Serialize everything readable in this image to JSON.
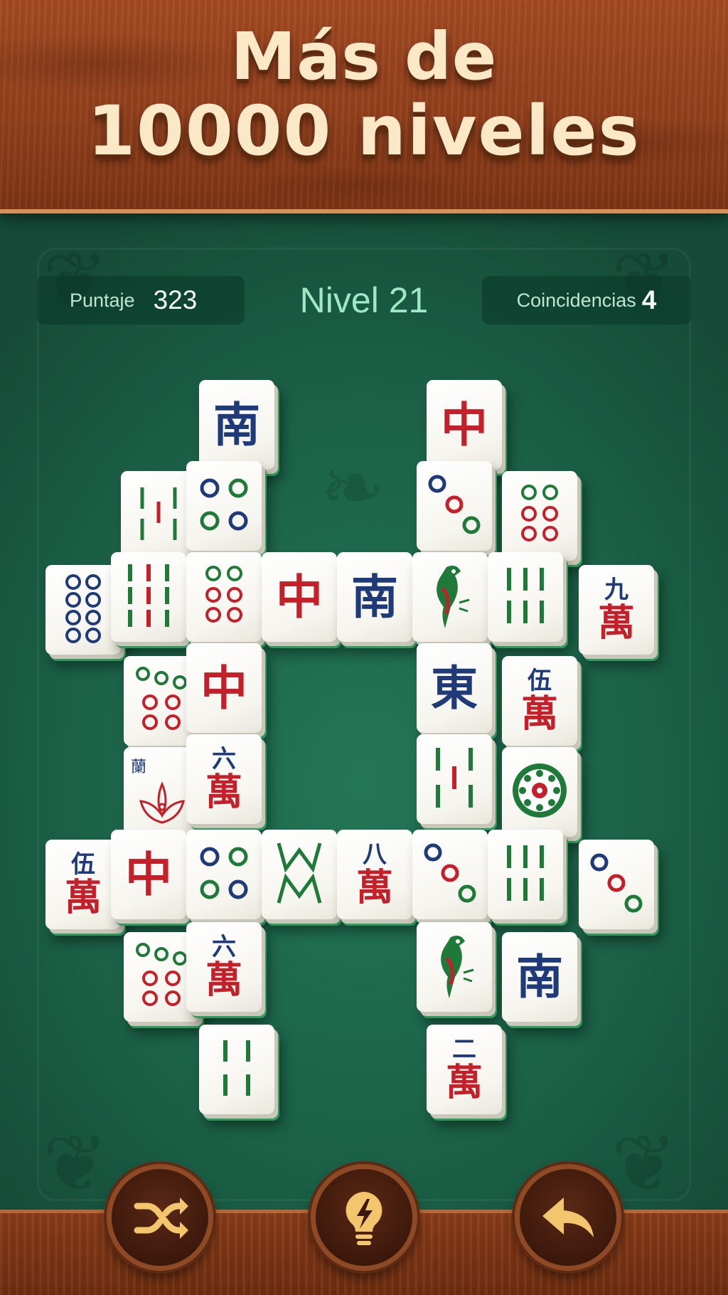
{
  "banner": {
    "line1": "Más de",
    "line2": "10000 niveles"
  },
  "hud": {
    "score_label": "Puntaje",
    "score_value": "323",
    "level_title": "Nivel 21",
    "matches_label": "Coincidencias",
    "matches_value": "4"
  },
  "colors": {
    "board_green": "#1d5e47",
    "wood": "#93401c",
    "headline": "#fbe8c6",
    "tile_red": "#c5202a",
    "tile_blue": "#1e3a78",
    "tile_green": "#1f7a3a"
  },
  "tiles": [
    {
      "glyph": "南",
      "kind": "south-wind"
    },
    {
      "glyph": "中",
      "kind": "red-dragon"
    },
    {
      "glyph": "𝍪",
      "kind": "bamboo-3"
    },
    {
      "glyph": "◎◎\n◎◎",
      "kind": "circles-4"
    },
    {
      "glyph": "◎◎\n◎◎",
      "kind": "circles-3"
    },
    {
      "glyph": "◎◎\n◎◎◎",
      "kind": "circles-6"
    },
    {
      "glyph": "◎◎\n◎◎\n◎◎",
      "kind": "circles-8"
    },
    {
      "glyph": "‖‖‖",
      "kind": "bamboo-9"
    },
    {
      "glyph": "◎◎\n◎◎◎",
      "kind": "circles-6"
    },
    {
      "glyph": "中",
      "kind": "red-dragon"
    },
    {
      "glyph": "南",
      "kind": "south-wind"
    },
    {
      "glyph": "🐦",
      "kind": "bamboo-1"
    },
    {
      "glyph": "‖‖‖",
      "kind": "bamboo-6"
    },
    {
      "num": "九",
      "wan": "萬",
      "kind": "characters-9"
    },
    {
      "glyph": "◎◎\n◎◎◎",
      "kind": "circles-7"
    },
    {
      "glyph": "中",
      "kind": "red-dragon"
    },
    {
      "glyph": "東",
      "kind": "east-wind"
    },
    {
      "num": "伍",
      "wan": "萬",
      "kind": "characters-5"
    },
    {
      "glyph": "蘭",
      "kind": "flower-orchid"
    },
    {
      "num": "六",
      "wan": "萬",
      "kind": "characters-6"
    },
    {
      "glyph": "‖|‖",
      "kind": "bamboo-5"
    },
    {
      "glyph": "❁",
      "kind": "circles-1"
    },
    {
      "num": "伍",
      "wan": "萬",
      "kind": "characters-5"
    },
    {
      "glyph": "中",
      "kind": "red-dragon"
    },
    {
      "glyph": "◎◎\n◎◎",
      "kind": "circles-4"
    },
    {
      "glyph": "WM",
      "kind": "bamboo-8"
    },
    {
      "num": "八",
      "wan": "萬",
      "kind": "characters-8"
    },
    {
      "glyph": "◎◎◎",
      "kind": "circles-3"
    },
    {
      "glyph": "‖‖‖",
      "kind": "bamboo-6"
    },
    {
      "glyph": "◎◎◎",
      "kind": "circles-3"
    },
    {
      "glyph": "◎◎\n◎◎◎",
      "kind": "circles-7"
    },
    {
      "num": "六",
      "wan": "萬",
      "kind": "characters-6"
    },
    {
      "glyph": "🐦",
      "kind": "bamboo-1"
    },
    {
      "glyph": "南",
      "kind": "south-wind"
    },
    {
      "glyph": "‖ ‖",
      "kind": "bamboo-4"
    },
    {
      "num": "二",
      "wan": "萬",
      "kind": "characters-2"
    }
  ],
  "toolbar": {
    "shuffle_icon": "shuffle-icon",
    "hint_icon": "lightbulb-icon",
    "undo_icon": "undo-arrow-icon"
  }
}
